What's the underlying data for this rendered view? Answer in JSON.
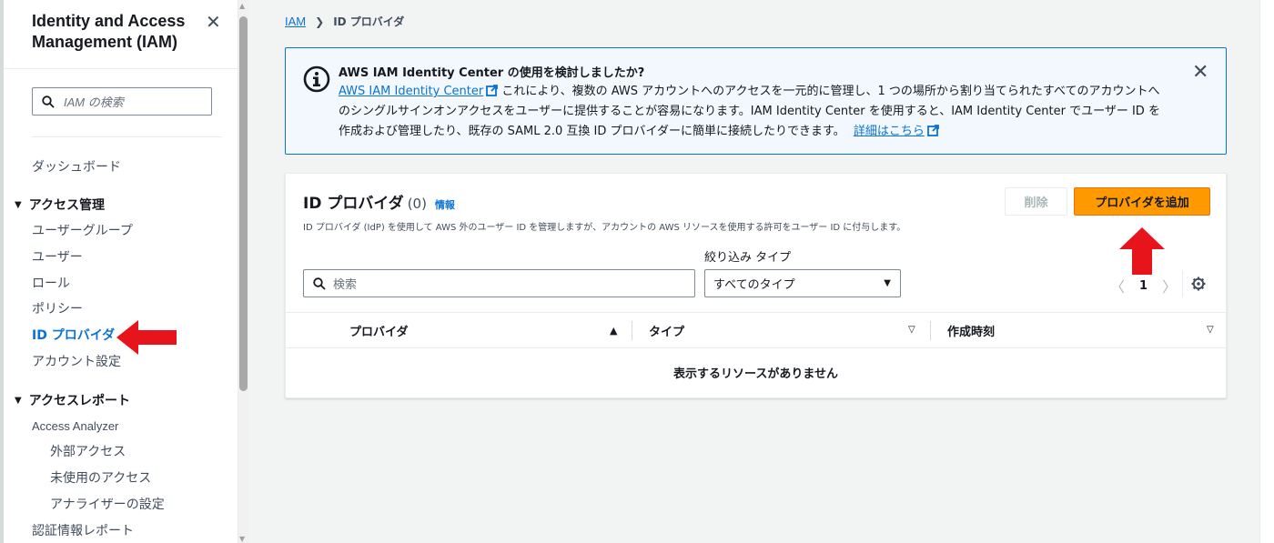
{
  "sidebar": {
    "title_line1": "Identity and Access",
    "title_line2": "Management (IAM)",
    "search_placeholder": "IAM の検索",
    "dashboard": "ダッシュボード",
    "access_management": {
      "label": "アクセス管理",
      "items": [
        "ユーザーグループ",
        "ユーザー",
        "ロール",
        "ポリシー",
        "ID プロバイダ",
        "アカウント設定"
      ]
    },
    "access_reports": {
      "label": "アクセスレポート",
      "analyzer": "Access Analyzer",
      "sub_items": [
        "外部アクセス",
        "未使用のアクセス",
        "アナライザーの設定"
      ],
      "credential_report": "認証情報レポート"
    }
  },
  "breadcrumb": {
    "root": "IAM",
    "current": "ID プロバイダ"
  },
  "alert": {
    "title": "AWS IAM Identity Center の使用を検討しましたか?",
    "link": "AWS IAM Identity Center",
    "body_line1": " これにより、複数の AWS アカウントへのアクセスを一元的に管理し、1 つの場所から割り当てられたすべてのアカウントへ",
    "body_line2": "のシングルサインオンアクセスをユーザーに提供することが容易になります。IAM Identity Center を使用すると、IAM Identity Center でユーザー ID を",
    "body_line3": "作成および管理したり、既存の SAML 2.0 互換 ID プロバイダーに簡単に接続したりできます。",
    "learn_more": "詳細はこちら"
  },
  "panel": {
    "title": "ID プロバイダ",
    "count": "(0)",
    "info": "情報",
    "description": "ID プロバイダ (IdP) を使用して AWS 外のユーザー ID を管理しますが、アカウントの AWS リソースを使用する許可をユーザー ID に付与します。",
    "delete_button": "削除",
    "add_button": "プロバイダを追加",
    "search_placeholder": "検索",
    "filter_label": "絞り込み タイプ",
    "filter_value": "すべてのタイプ",
    "page": "1",
    "columns": [
      "プロバイダ",
      "タイプ",
      "作成時刻"
    ],
    "empty_message": "表示するリソースがありません"
  },
  "colors": {
    "accent": "#0972d3",
    "primary_button": "#ff9900",
    "alert_bg": "#f2f8fd",
    "annotation_arrow": "#e8141b"
  }
}
